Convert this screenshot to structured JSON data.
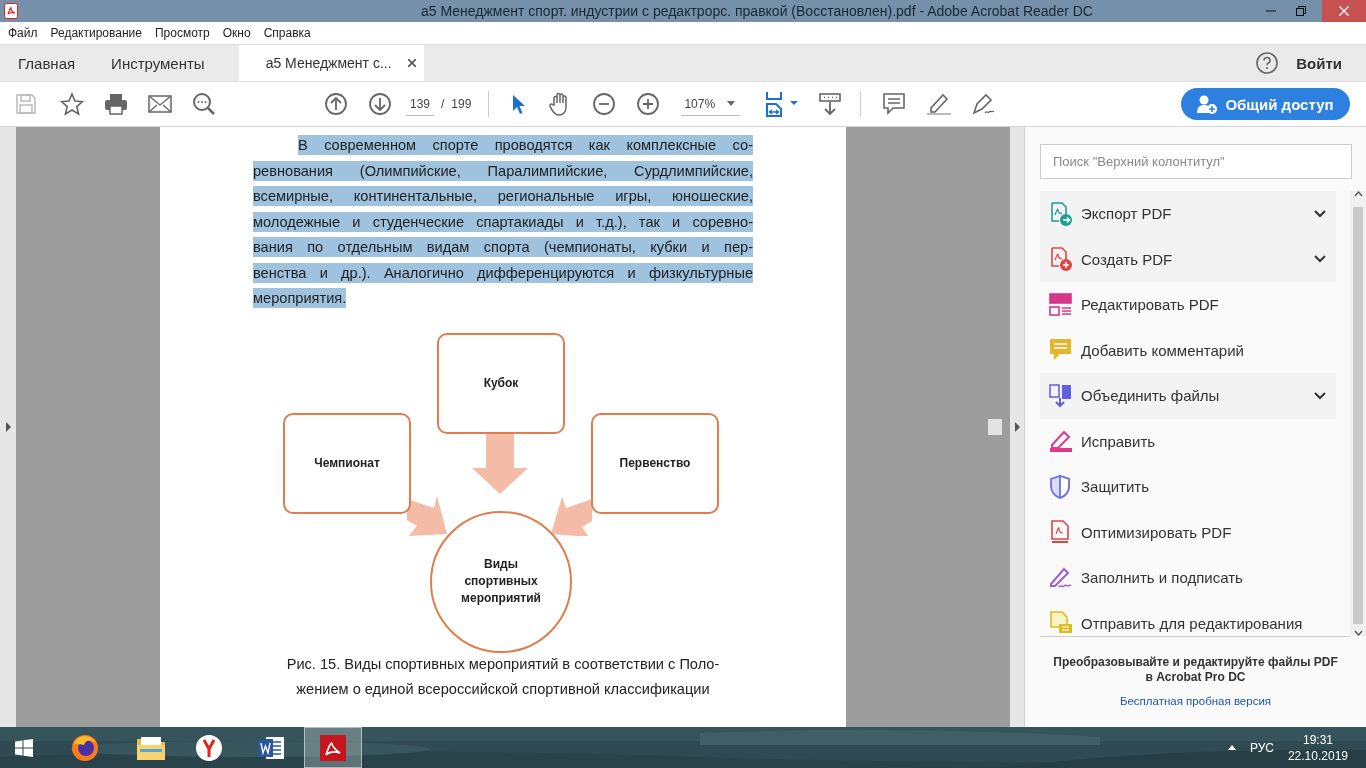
{
  "window": {
    "title": "a5 Менеджмент спорт. индустрии с редактрорс. правкой (Восстановлен).pdf - Adobe Acrobat Reader DC"
  },
  "menu": [
    "Файл",
    "Редактирование",
    "Просмотр",
    "Окно",
    "Справка"
  ],
  "tabs": [
    {
      "label": "Главная",
      "selected": false,
      "closable": false
    },
    {
      "label": "Инструменты",
      "selected": false,
      "closable": false
    },
    {
      "label": "a5 Менеджмент с...",
      "selected": true,
      "closable": true
    }
  ],
  "account": {
    "sign_in": "Войти"
  },
  "toolbar": {
    "save_disabled": true,
    "page": "139",
    "page_separator": "/",
    "page_count": "199",
    "zoom": "107%",
    "share": "Общий доступ"
  },
  "document": {
    "paragraph_lines": [
      "В современном спорте проводятся как комплексные со-",
      "ревнования (Олимпийские, Паралимпийские, Сурдлимпийские,",
      "всемирные, континентальные, региональные игры, юношеские,",
      "молодежные и студенческие спартакиады и т.д.), так и соревно-",
      "вания по отдельным видам спорта (чемпионаты, кубки и пер-",
      "венства и др.). Аналогично дифференцируются и физкультурные",
      "мероприятия."
    ],
    "highlighted": true,
    "diagram": {
      "nodes": [
        {
          "label": "Кубок",
          "kind": "box"
        },
        {
          "label": "Чемпионат",
          "kind": "box"
        },
        {
          "label": "Первенство",
          "kind": "box"
        },
        {
          "label": "Виды спортивных мероприятий",
          "kind": "circle"
        }
      ]
    },
    "caption_lines": [
      "Рис. 15.  Виды спортивных мероприятий в соответствии с Поло-",
      "жением о единой всероссийской спортивной классификации"
    ]
  },
  "tools_panel": {
    "search_placeholder": "Поиск \"Верхний колонтитул\"",
    "items": [
      {
        "label": "Экспорт PDF",
        "color": "#1b9e94",
        "expandable": true
      },
      {
        "label": "Создать PDF",
        "color": "#e04545",
        "expandable": true
      },
      {
        "label": "Редактировать PDF",
        "color": "#d6368a",
        "expandable": false
      },
      {
        "label": "Добавить комментарий",
        "color": "#e2b72b",
        "expandable": false
      },
      {
        "label": "Объединить файлы",
        "color": "#5f5fe0",
        "expandable": true
      },
      {
        "label": "Исправить",
        "color": "#df3a8a",
        "expandable": false
      },
      {
        "label": "Защитить",
        "color": "#7070e0",
        "expandable": false
      },
      {
        "label": "Оптимизировать PDF",
        "color": "#e04545",
        "expandable": false
      },
      {
        "label": "Заполнить и подписать",
        "color": "#9a5ce0",
        "expandable": false
      },
      {
        "label": "Отправить для редактирования",
        "color": "#dcbc20",
        "expandable": false
      }
    ],
    "promo": "Преобразовывайте и редактируйте файлы PDF в Acrobat Pro DC",
    "trial_link": "Бесплатная пробная версия"
  },
  "taskbar": {
    "apps": [
      {
        "kind": "start",
        "selected": false
      },
      {
        "kind": "firefox",
        "selected": false
      },
      {
        "kind": "folder",
        "selected": false
      },
      {
        "kind": "yandex",
        "selected": false
      },
      {
        "kind": "word",
        "selected": false
      },
      {
        "kind": "pdf",
        "selected": true
      }
    ],
    "language": "РУС",
    "time": "19:31",
    "date": "22.10.2019"
  }
}
